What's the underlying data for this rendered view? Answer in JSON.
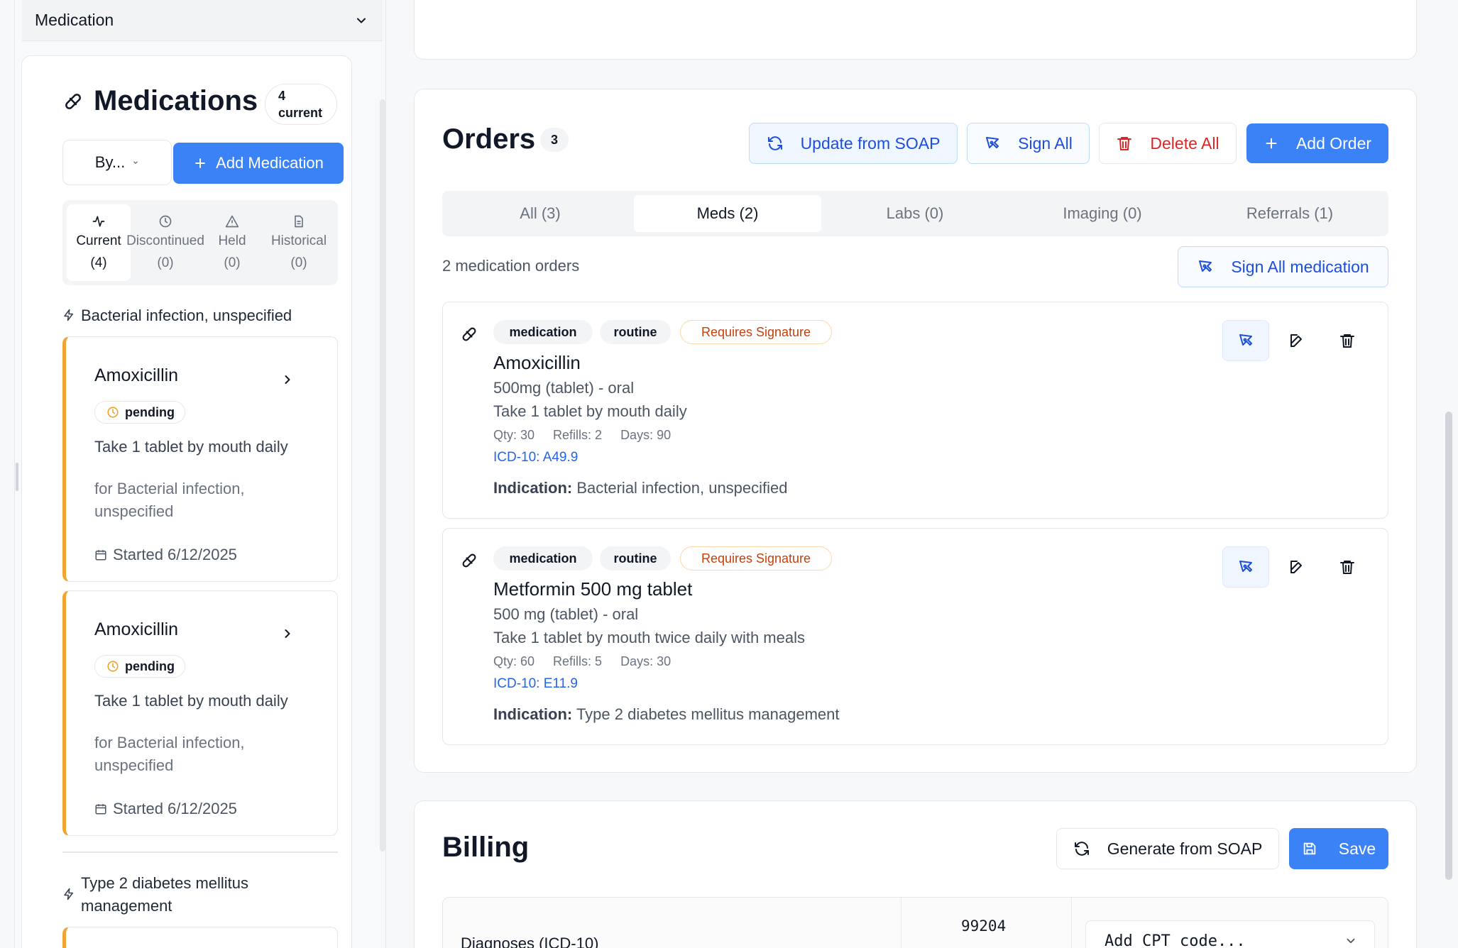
{
  "sidebar": {
    "accordion_label": "Medication",
    "title": "Medications",
    "count_number": "4",
    "count_label": "current",
    "sort_select": "By...",
    "add_button": "Add Medication",
    "tabs": [
      {
        "label": "Current",
        "count": "(4)",
        "icon": "activity-icon"
      },
      {
        "label": "Discontinued",
        "count": "(0)",
        "icon": "clock-icon"
      },
      {
        "label": "Held",
        "count": "(0)",
        "icon": "alert-triangle-icon"
      },
      {
        "label": "Historical",
        "count": "(0)",
        "icon": "document-icon"
      }
    ],
    "groups": [
      {
        "label": "Bacterial infection, unspecified",
        "meds": [
          {
            "name": "Amoxicillin",
            "status": "pending",
            "instructions": "Take 1 tablet by mouth daily",
            "for": "for Bacterial infection, unspecified",
            "started": "Started 6/12/2025"
          },
          {
            "name": "Amoxicillin",
            "status": "pending",
            "instructions": "Take 1 tablet by mouth daily",
            "for": "for Bacterial infection, unspecified",
            "started": "Started 6/12/2025"
          }
        ]
      },
      {
        "label": "Type 2 diabetes mellitus management",
        "meds": []
      }
    ]
  },
  "orders": {
    "title": "Orders",
    "count": "3",
    "buttons": {
      "update_soap": "Update from SOAP",
      "sign_all": "Sign All",
      "delete_all": "Delete All",
      "add_order": "Add Order"
    },
    "filter_tabs": [
      {
        "label": "All (3)"
      },
      {
        "label": "Meds (2)"
      },
      {
        "label": "Labs (0)"
      },
      {
        "label": "Imaging (0)"
      },
      {
        "label": "Referrals (1)"
      }
    ],
    "subtitle": "2 medication orders",
    "sign_all_medication": "Sign All medication",
    "items": [
      {
        "tags": [
          "medication",
          "routine",
          "Requires Signature"
        ],
        "name": "Amoxicillin",
        "dose": "500mg (tablet) - oral",
        "instructions": "Take 1 tablet by mouth daily",
        "qty": "Qty: 30",
        "refills": "Refills: 2",
        "days": "Days: 90",
        "icd": "ICD-10: A49.9",
        "indication_label": "Indication:",
        "indication": "Bacterial infection, unspecified"
      },
      {
        "tags": [
          "medication",
          "routine",
          "Requires Signature"
        ],
        "name": "Metformin 500 mg tablet",
        "dose": "500 mg (tablet) - oral",
        "instructions": "Take 1 tablet by mouth twice daily with meals",
        "qty": "Qty: 60",
        "refills": "Refills: 5",
        "days": "Days: 30",
        "icd": "ICD-10: E11.9",
        "indication_label": "Indication:",
        "indication": "Type 2 diabetes mellitus management"
      }
    ]
  },
  "billing": {
    "title": "Billing",
    "generate_button": "Generate from SOAP",
    "save_button": "Save",
    "diagnoses_header": "Diagnoses (ICD-10)",
    "cpt_code": "99204",
    "cpt_placeholder": "Add CPT code..."
  },
  "colors": {
    "primary": "#3b82f6",
    "danger": "#dc2626",
    "pending_accent": "#f0a431",
    "warning_text": "#c2410c",
    "link": "#2563eb"
  }
}
